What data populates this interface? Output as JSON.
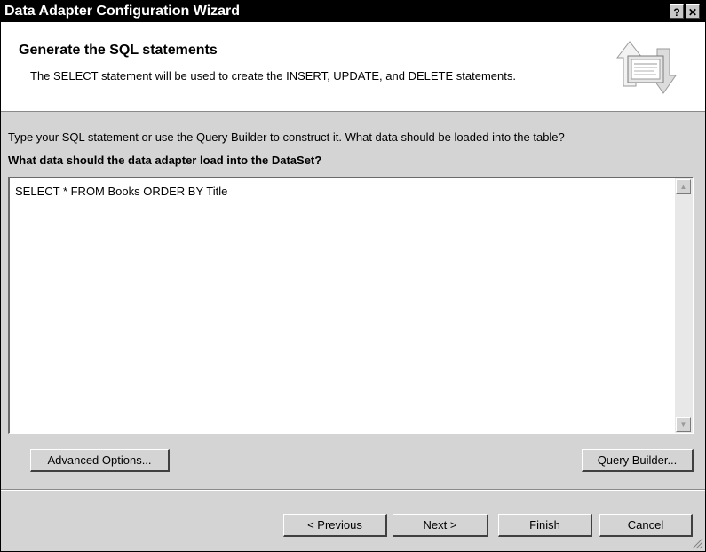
{
  "window": {
    "title": "Data Adapter Configuration Wizard",
    "help_glyph": "?",
    "close_glyph": "✕"
  },
  "header": {
    "title": "Generate the SQL statements",
    "description": "The SELECT statement will be used to create the INSERT, UPDATE, and DELETE statements.",
    "icon": "wizard-header-icon"
  },
  "main": {
    "instruction": "Type your SQL statement or use the Query Builder to construct it. What data should be loaded into the table?",
    "question": "What data should the data adapter load into the DataSet?",
    "sql_text": "SELECT * FROM Books ORDER BY Title",
    "advanced_options_label": "Advanced Options...",
    "query_builder_label": "Query Builder..."
  },
  "footer": {
    "previous_label": "< Previous",
    "next_label": "Next >",
    "finish_label": "Finish",
    "cancel_label": "Cancel"
  }
}
